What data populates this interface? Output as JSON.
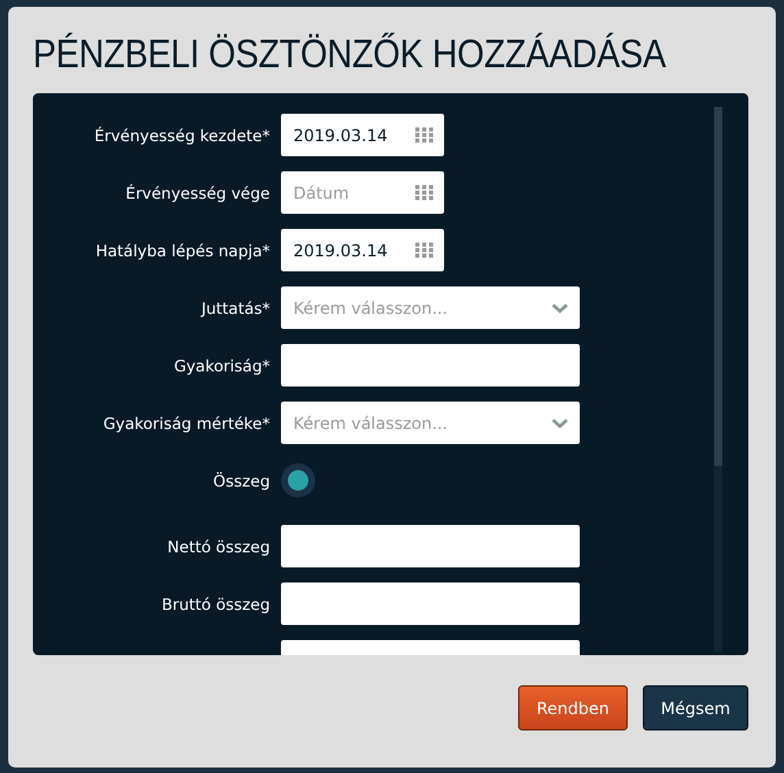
{
  "dialog": {
    "title": "PÉNZBELI ÖSZTÖNZŐK HOZZÁADÁSA",
    "fields": [
      {
        "kind": "date",
        "label": "Érvényesség kezdete*",
        "value": "2019.03.14"
      },
      {
        "kind": "date",
        "label": "Érvényesség vége",
        "placeholder": "Dátum"
      },
      {
        "kind": "date",
        "label": "Hatályba lépés napja*",
        "value": "2019.03.14"
      },
      {
        "kind": "select",
        "label": "Juttatás*",
        "placeholder": "Kérem válasszon..."
      },
      {
        "kind": "text",
        "label": "Gyakoriság*"
      },
      {
        "kind": "select",
        "label": "Gyakoriság mértéke*",
        "placeholder": "Kérem válasszon..."
      },
      {
        "kind": "radio",
        "label": "Összeg",
        "checked": true
      },
      {
        "kind": "text",
        "label": "Nettó összeg"
      },
      {
        "kind": "text",
        "label": "Bruttó összeg"
      },
      {
        "kind": "text"
      }
    ],
    "buttons": [
      {
        "kind": "primary",
        "label": "Rendben"
      },
      {
        "kind": "secondary",
        "label": "Mégsem"
      }
    ]
  }
}
